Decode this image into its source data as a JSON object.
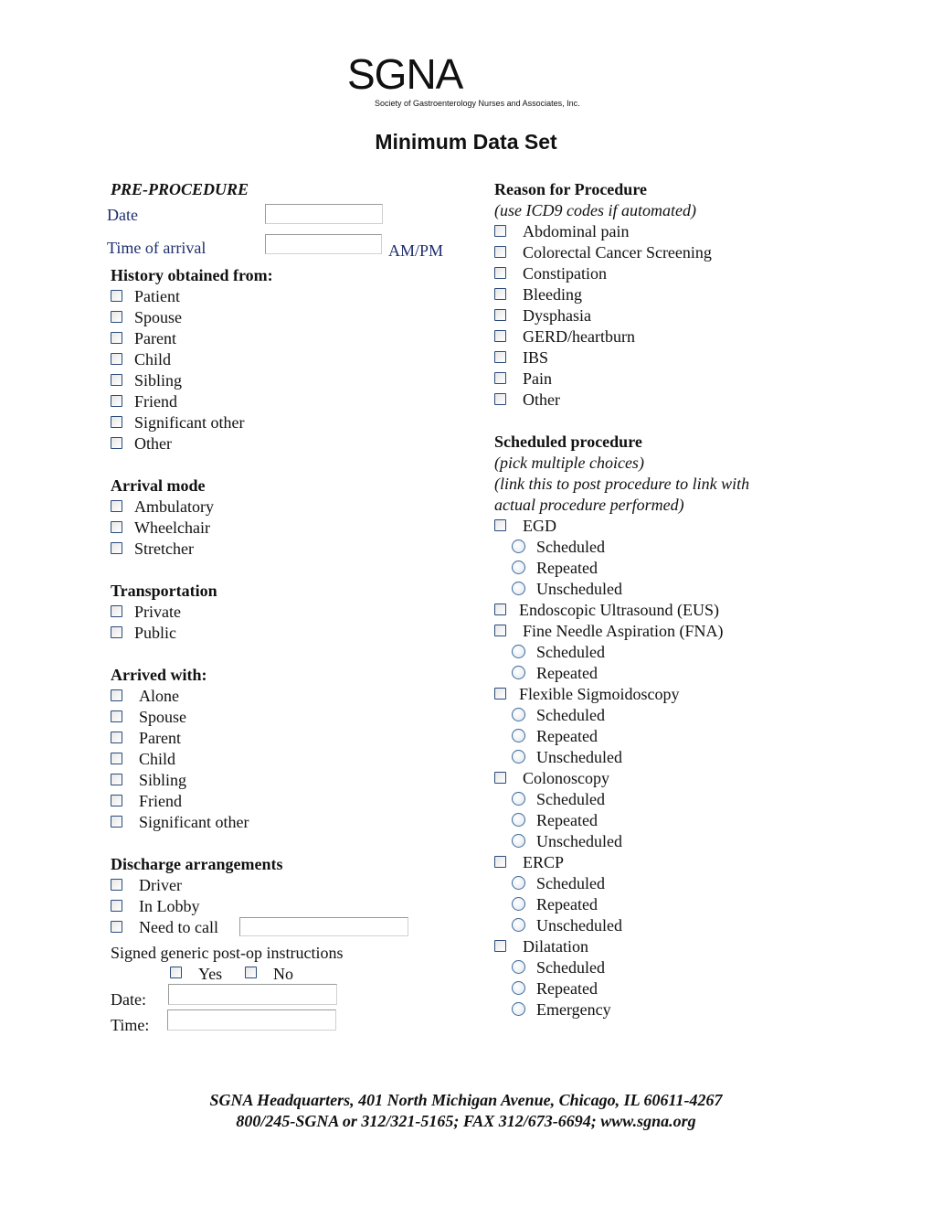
{
  "logo": {
    "wordmark": "SGNA",
    "tagline": "Society of Gastroenterology Nurses and Associates, Inc."
  },
  "title": "Minimum Data Set",
  "pre_procedure": {
    "heading": "PRE-PROCEDURE",
    "date_label": "Date",
    "date_value": "",
    "time_label": "Time of arrival",
    "time_value": "",
    "ampm": "AM/PM"
  },
  "history": {
    "heading": "History obtained from:",
    "items": [
      "Patient",
      "Spouse",
      "Parent",
      "Child",
      "Sibling",
      "Friend",
      "Significant other",
      "Other"
    ]
  },
  "arrival_mode": {
    "heading": "Arrival mode",
    "items": [
      "Ambulatory",
      "Wheelchair",
      "Stretcher"
    ]
  },
  "transportation": {
    "heading": "Transportation",
    "items": [
      "Private",
      "Public"
    ]
  },
  "arrived_with": {
    "heading": "Arrived with:",
    "items": [
      "Alone",
      "Spouse",
      "Parent",
      "Child",
      "Sibling",
      "Friend",
      "Significant other"
    ]
  },
  "discharge": {
    "heading": "Discharge arrangements",
    "items": [
      "Driver",
      "In Lobby",
      "Need to call"
    ],
    "need_to_call_value": "",
    "signed_label": "Signed generic post-op instructions",
    "yes": "Yes",
    "no": "No",
    "date_label": "Date:",
    "date_value": "",
    "time_label": "Time:",
    "time_value": ""
  },
  "reason": {
    "heading": "Reason for Procedure",
    "note": "(use ICD9 codes if automated)",
    "items": [
      "Abdominal pain",
      "Colorectal Cancer Screening",
      "Constipation",
      "Bleeding",
      "Dysphasia",
      "GERD/heartburn",
      "IBS",
      "Pain",
      "Other"
    ]
  },
  "scheduled": {
    "heading": "Scheduled procedure",
    "note1": "(pick multiple choices)",
    "note2": "(link this to post procedure to link with",
    "note3": "actual procedure performed)",
    "rows": [
      {
        "type": "cb",
        "label": "EGD"
      },
      {
        "type": "rb",
        "label": "Scheduled"
      },
      {
        "type": "rb",
        "label": "Repeated"
      },
      {
        "type": "rb",
        "label": "Unscheduled"
      },
      {
        "type": "cb",
        "label": "Endoscopic Ultrasound (EUS)"
      },
      {
        "type": "cb",
        "label": "Fine Needle Aspiration (FNA)"
      },
      {
        "type": "rb",
        "label": "Scheduled"
      },
      {
        "type": "rb",
        "label": "Repeated"
      },
      {
        "type": "cb",
        "label": "Flexible Sigmoidoscopy"
      },
      {
        "type": "rb",
        "label": "Scheduled"
      },
      {
        "type": "rb",
        "label": "Repeated"
      },
      {
        "type": "rb",
        "label": "Unscheduled"
      },
      {
        "type": "cb",
        "label": "Colonoscopy"
      },
      {
        "type": "rb",
        "label": "Scheduled"
      },
      {
        "type": "rb",
        "label": "Repeated"
      },
      {
        "type": "rb",
        "label": "Unscheduled"
      },
      {
        "type": "cb",
        "label": "ERCP"
      },
      {
        "type": "rb",
        "label": "Scheduled"
      },
      {
        "type": "rb",
        "label": "Repeated"
      },
      {
        "type": "rb",
        "label": "Unscheduled"
      },
      {
        "type": "cb",
        "label": "Dilatation"
      },
      {
        "type": "rb",
        "label": "Scheduled"
      },
      {
        "type": "rb",
        "label": "Repeated"
      },
      {
        "type": "rb",
        "label": "Emergency"
      }
    ]
  },
  "footer": {
    "line1": "SGNA Headquarters, 401 North Michigan Avenue, Chicago, IL 60611-4267",
    "line2": "800/245-SGNA or 312/321-5165; FAX 312/673-6694; www.sgna.org"
  }
}
